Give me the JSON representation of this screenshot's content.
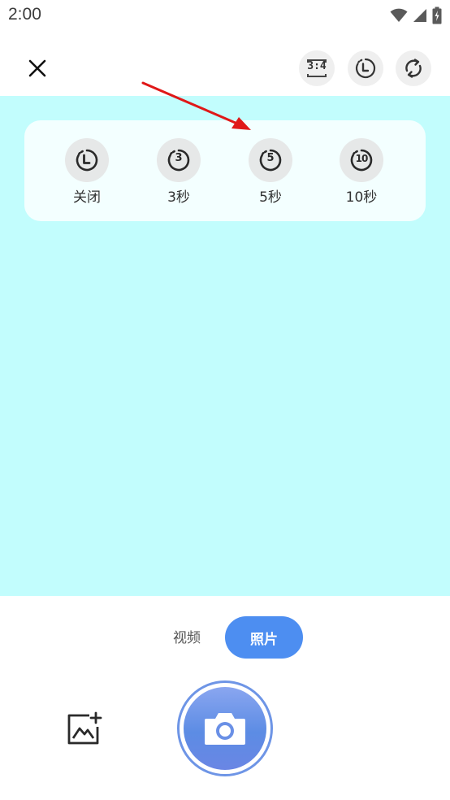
{
  "status_bar": {
    "time": "2:00",
    "icons": [
      "wifi-icon",
      "signal-icon",
      "battery-icon"
    ]
  },
  "toolbar": {
    "close_icon": "close-icon",
    "aspect_ratio_label": "3:4",
    "timer_icon": "timer-icon",
    "flip_camera_icon": "flip-camera-icon"
  },
  "timer_panel": {
    "options": [
      {
        "label": "关闭",
        "icon": "timer-off-icon",
        "digit": ""
      },
      {
        "label": "3秒",
        "icon": "timer-3s-icon",
        "digit": "3"
      },
      {
        "label": "5秒",
        "icon": "timer-5s-icon",
        "digit": "5"
      },
      {
        "label": "10秒",
        "icon": "timer-10s-icon",
        "digit": "10"
      }
    ]
  },
  "annotation": {
    "arrow_color": "#e01818"
  },
  "mode_switch": {
    "video_label": "视频",
    "photo_label": "照片",
    "selected": "照片"
  },
  "bottom_bar": {
    "gallery_icon": "gallery-add-icon",
    "shutter_icon": "camera-icon"
  },
  "colors": {
    "preview_bg": "#c2fdfd",
    "accent": "#4d8ef1"
  }
}
